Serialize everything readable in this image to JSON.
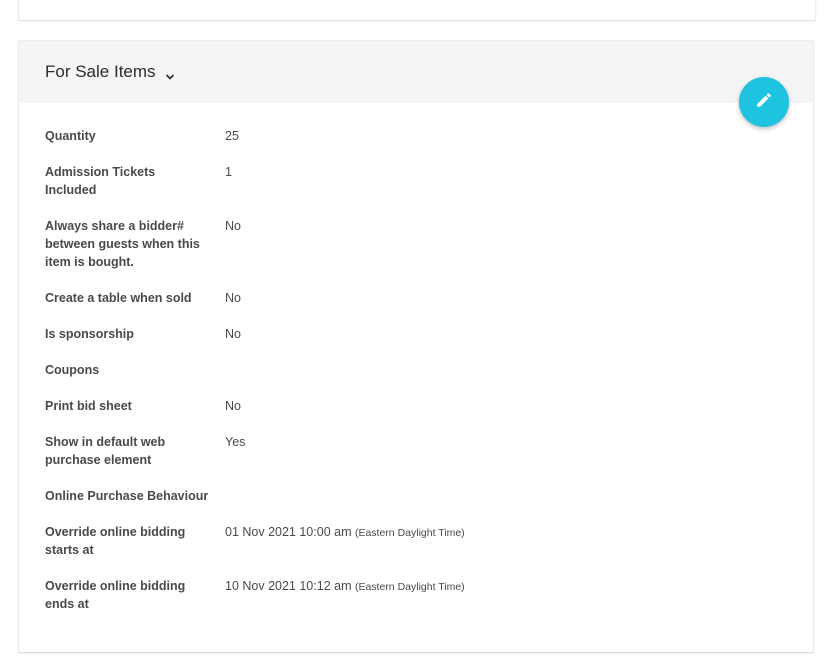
{
  "section": {
    "title": "For Sale Items",
    "edit_icon": "pencil-icon",
    "expand_icon": "chevron-down-icon",
    "accent_color": "#1ec3e0"
  },
  "fields": [
    {
      "label": "Quantity",
      "value": "25"
    },
    {
      "label": "Admission Tickets Included",
      "value": "1"
    },
    {
      "label": "Always share a bidder# between guests when this item is bought.",
      "value": "No"
    },
    {
      "label": "Create a table when sold",
      "value": "No"
    },
    {
      "label": "Is sponsorship",
      "value": "No"
    },
    {
      "label": "Coupons",
      "value": ""
    },
    {
      "label": "Print bid sheet",
      "value": "No"
    },
    {
      "label": "Show in default web purchase element",
      "value": "Yes"
    },
    {
      "label": "Online Purchase Behaviour",
      "value": ""
    },
    {
      "label": "Override online bidding starts at",
      "value": "01 Nov 2021 10:00 am",
      "tz": "(Eastern Daylight Time)"
    },
    {
      "label": "Override online bidding ends at",
      "value": "10 Nov 2021 10:12 am",
      "tz": "(Eastern Daylight Time)"
    }
  ]
}
